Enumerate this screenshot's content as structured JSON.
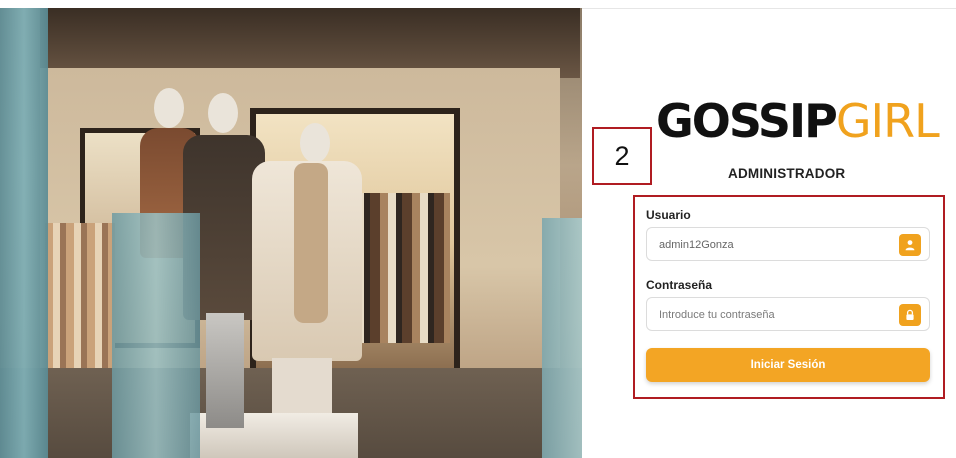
{
  "hero_image": {
    "description_icon": "store-photo"
  },
  "brand": {
    "logo_part1": "GOSSIP",
    "logo_part2": "GIRL",
    "color_dark": "#111111",
    "color_accent": "#f0a21e"
  },
  "annotation": {
    "step_number": "2",
    "border_color": "#b01c22"
  },
  "login": {
    "role_heading": "ADMINISTRADOR",
    "username_label": "Usuario",
    "username_value": "admin12Gonza",
    "username_icon": "user-icon",
    "password_label": "Contraseña",
    "password_placeholder": "Introduce tu contraseña",
    "password_icon": "lock-icon",
    "submit_label": "Iniciar Sesión",
    "button_color": "#f3a524"
  }
}
